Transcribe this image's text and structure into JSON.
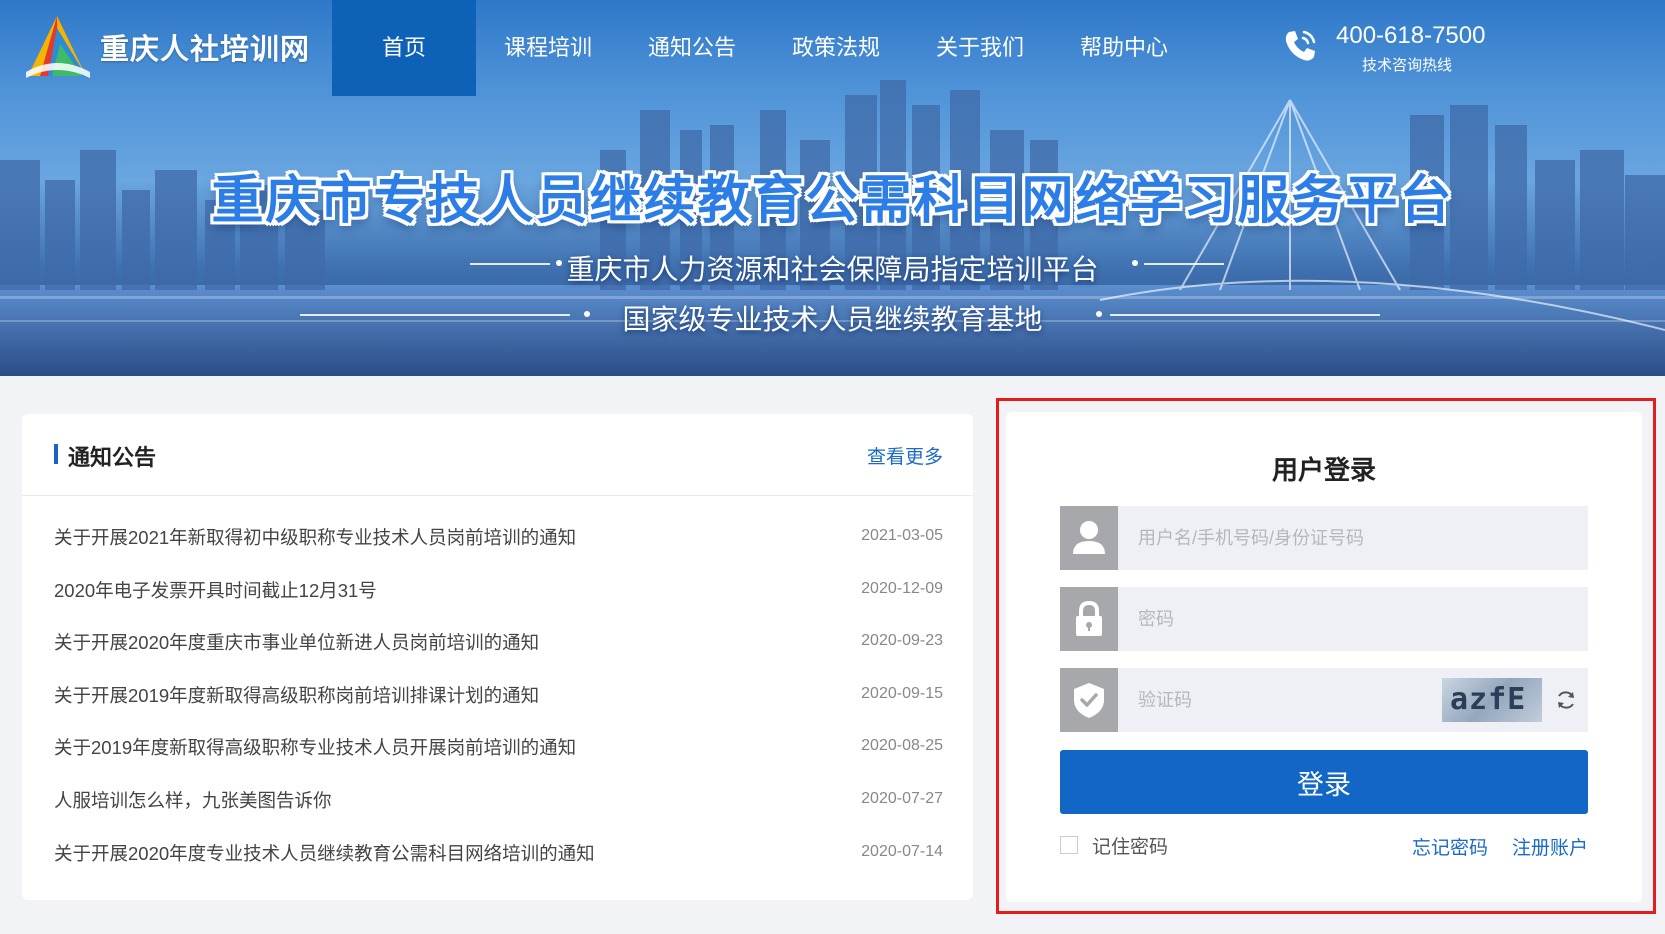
{
  "header": {
    "site_name": "重庆人社培训网",
    "nav": [
      {
        "label": "首页",
        "active": true
      },
      {
        "label": "课程培训",
        "active": false
      },
      {
        "label": "通知公告",
        "active": false
      },
      {
        "label": "政策法规",
        "active": false
      },
      {
        "label": "关于我们",
        "active": false
      },
      {
        "label": "帮助中心",
        "active": false
      }
    ],
    "hotline_number": "400-618-7500",
    "hotline_label": "技术咨询热线"
  },
  "banner": {
    "title": "重庆市专技人员继续教育公需科目网络学习服务平台",
    "subtitle1": "重庆市人力资源和社会保障局指定培训平台",
    "subtitle2": "国家级专业技术人员继续教育基地"
  },
  "notices": {
    "title": "通知公告",
    "more_label": "查看更多",
    "items": [
      {
        "text": "关于开展2021年新取得初中级职称专业技术人员岗前培训的通知",
        "date": "2021-03-05"
      },
      {
        "text": "2020年电子发票开具时间截止12月31号",
        "date": "2020-12-09"
      },
      {
        "text": "关于开展2020年度重庆市事业单位新进人员岗前培训的通知",
        "date": "2020-09-23"
      },
      {
        "text": "关于开展2019年度新取得高级职称岗前培训排课计划的通知",
        "date": "2020-09-15"
      },
      {
        "text": "关于2019年度新取得高级职称专业技术人员开展岗前培训的通知",
        "date": "2020-08-25"
      },
      {
        "text": "人服培训怎么样，九张美图告诉你",
        "date": "2020-07-27"
      },
      {
        "text": "关于开展2020年度专业技术人员继续教育公需科目网络培训的通知",
        "date": "2020-07-14"
      }
    ]
  },
  "login": {
    "title": "用户登录",
    "username_placeholder": "用户名/手机号码/身份证号码",
    "username_value": "",
    "password_placeholder": "密码",
    "password_value": "",
    "captcha_placeholder": "验证码",
    "captcha_value": "",
    "captcha_text": "azfE",
    "submit_label": "登录",
    "remember_label": "记住密码",
    "remember_checked": false,
    "forgot_label": "忘记密码",
    "register_label": "注册账户",
    "highlight_color": "#e51c1c"
  },
  "icons": {
    "logo": "logo-icon",
    "phone": "phone-icon",
    "user": "user-icon",
    "lock": "lock-icon",
    "shield": "shield-check-icon",
    "refresh": "refresh-icon"
  },
  "colors": {
    "nav_active": "#0d62b7",
    "primary": "#1266c6",
    "link": "#1a6ac7",
    "field_bg": "#eef0f5",
    "icon_bg": "#a6a8ab"
  }
}
